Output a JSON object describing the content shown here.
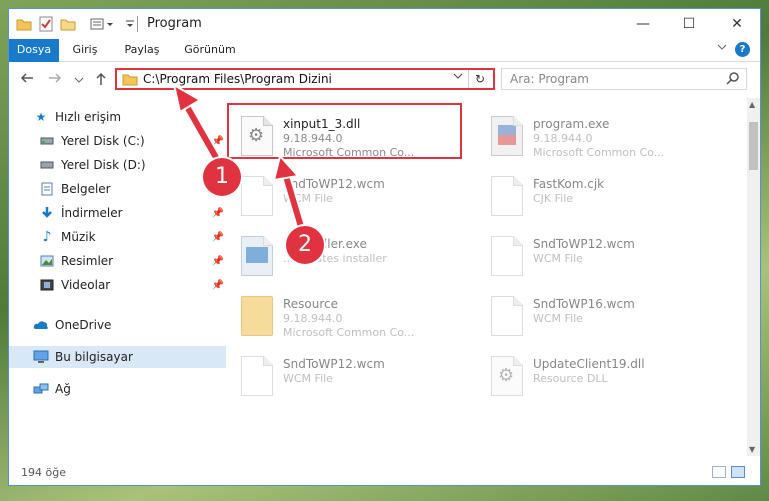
{
  "window": {
    "title": "Program"
  },
  "title_buttons": {
    "minimize": "—",
    "maximize": "☐",
    "close": "✕"
  },
  "ribbon": {
    "tabs": [
      "Dosya",
      "Giriş",
      "Paylaş",
      "Görünüm"
    ],
    "help": "?"
  },
  "nav": {
    "address": "C:\\Program Files\\Program Dizini",
    "search_placeholder": "Ara: Program"
  },
  "sidebar": {
    "items": [
      {
        "label": "Hızlı erişim",
        "icon": "star-icon",
        "pinned": false
      },
      {
        "label": "Yerel Disk (C:)",
        "icon": "drive-icon",
        "pinned": true
      },
      {
        "label": "Yerel Disk (D:)",
        "icon": "drive-icon",
        "pinned": true
      },
      {
        "label": "Belgeler",
        "icon": "documents-icon",
        "pinned": true
      },
      {
        "label": "İndirmeler",
        "icon": "download-icon",
        "pinned": true
      },
      {
        "label": "Müzik",
        "icon": "music-icon",
        "pinned": true
      },
      {
        "label": "Resimler",
        "icon": "pictures-icon",
        "pinned": true
      },
      {
        "label": "Videolar",
        "icon": "videos-icon",
        "pinned": true
      },
      {
        "label": "OneDrive",
        "icon": "cloud-icon",
        "pinned": false
      },
      {
        "label": "Bu bilgisayar",
        "icon": "computer-icon",
        "pinned": false
      },
      {
        "label": "Ağ",
        "icon": "network-icon",
        "pinned": false
      }
    ]
  },
  "files": [
    {
      "name": "xinput1_3.dll",
      "line1": "9.18.944.0",
      "line2": "Microsoft Common Co...",
      "icon": "dll-gear-icon"
    },
    {
      "name": "program.exe",
      "line1": "9.18.944.0",
      "line2": "Microsoft Common Co...",
      "icon": "exe-icon"
    },
    {
      "name": "SndToWP12.wcm",
      "line1": "WCM File",
      "line2": "",
      "icon": "file-icon"
    },
    {
      "name": "FastKom.cjk",
      "line1": "CJK File",
      "line2": "",
      "icon": "file-icon"
    },
    {
      "name": "...Installer.exe",
      "line1": "...Updates installer",
      "line2": "",
      "icon": "installer-icon"
    },
    {
      "name": "SndToWP12.wcm",
      "line1": "WCM File",
      "line2": "",
      "icon": "file-icon"
    },
    {
      "name": "Resource",
      "line1": "9.18.944.0",
      "line2": "Microsoft Common Co...",
      "icon": "folder-icon"
    },
    {
      "name": "SndToWP16.wcm",
      "line1": "WCM File",
      "line2": "",
      "icon": "file-icon"
    },
    {
      "name": "SndToWP12.wcm",
      "line1": "WCM File",
      "line2": "",
      "icon": "file-icon"
    },
    {
      "name": "UpdateClient19.dll",
      "line1": "Resource DLL",
      "line2": "",
      "icon": "dll-gear-icon"
    }
  ],
  "status": {
    "count": "194 öğe"
  },
  "annotations": {
    "badge1": "1",
    "badge2": "2"
  },
  "colors": {
    "accent": "#1979ca",
    "highlight": "#e0333f"
  }
}
